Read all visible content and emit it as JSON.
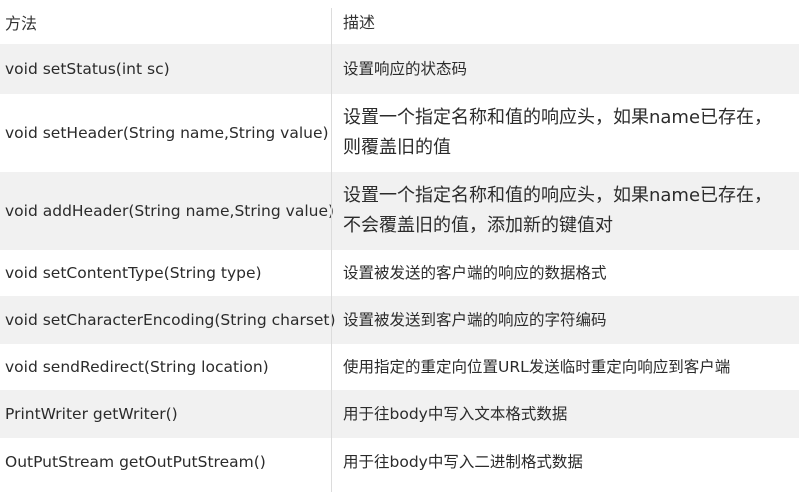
{
  "table": {
    "header": {
      "method": "方法",
      "description": "描述"
    },
    "rows": [
      {
        "method": "void setStatus(int sc)",
        "description": "设置响应的状态码"
      },
      {
        "method": "void setHeader(String name,String value)",
        "description": "设置一个指定名称和值的响应头，如果name已存在，则覆盖旧的值"
      },
      {
        "method": "void addHeader(String name,String value)",
        "description": "设置一个指定名称和值的响应头，如果name已存在，不会覆盖旧的值，添加新的键值对"
      },
      {
        "method": "void setContentType(String type)",
        "description": "设置被发送的客户端的响应的数据格式"
      },
      {
        "method": "void setCharacterEncoding(String charset)",
        "description": "设置被发送到客户端的响应的字符编码"
      },
      {
        "method": "void sendRedirect(String location)",
        "description": "使用指定的重定向位置URL发送临时重定向响应到客户端"
      },
      {
        "method": "PrintWriter getWriter()",
        "description": "用于往body中写入文本格式数据"
      },
      {
        "method": "OutPutStream getOutPutStream()",
        "description": "用于往body中写入二进制格式数据"
      }
    ]
  }
}
